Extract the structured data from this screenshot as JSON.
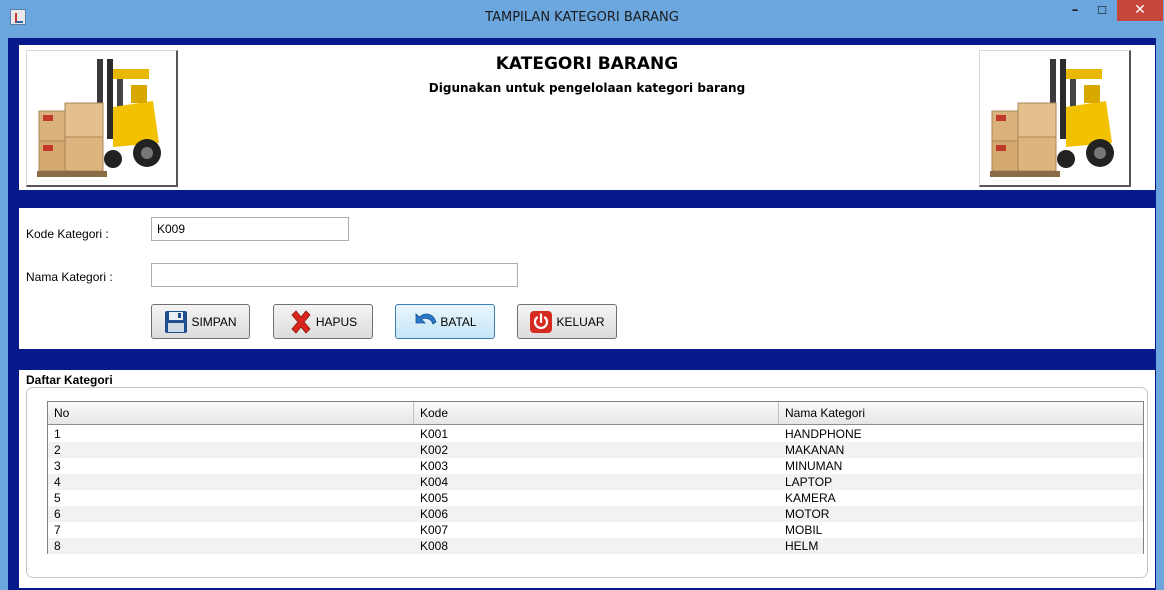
{
  "window": {
    "title": "TAMPILAN KATEGORI BARANG",
    "icon": "java-cup-icon"
  },
  "header": {
    "title": "KATEGORI BARANG",
    "subtitle": "Digunakan untuk pengelolaan kategori barang",
    "logo_icon": "forklift-boxes-icon"
  },
  "form": {
    "kode_label": "Kode Kategori :",
    "kode_value": "K009",
    "nama_label": "Nama Kategori :",
    "nama_value": ""
  },
  "buttons": {
    "simpan": "SIMPAN",
    "hapus": "HAPUS",
    "batal": "BATAL",
    "keluar": "KELUAR"
  },
  "list": {
    "caption": "Daftar Kategori",
    "columns": [
      "No",
      "Kode",
      "Nama Kategori"
    ],
    "rows": [
      [
        "1",
        "K001",
        "HANDPHONE"
      ],
      [
        "2",
        "K002",
        "MAKANAN"
      ],
      [
        "3",
        "K003",
        "MINUMAN"
      ],
      [
        "4",
        "K004",
        "LAPTOP"
      ],
      [
        "5",
        "K005",
        "KAMERA"
      ],
      [
        "6",
        "K006",
        "MOTOR"
      ],
      [
        "7",
        "K007",
        "MOBIL"
      ],
      [
        "8",
        "K008",
        "HELM"
      ]
    ]
  },
  "colors": {
    "frame": "#061a8c",
    "titlebar": "#6ba6de",
    "close": "#c7463a"
  }
}
